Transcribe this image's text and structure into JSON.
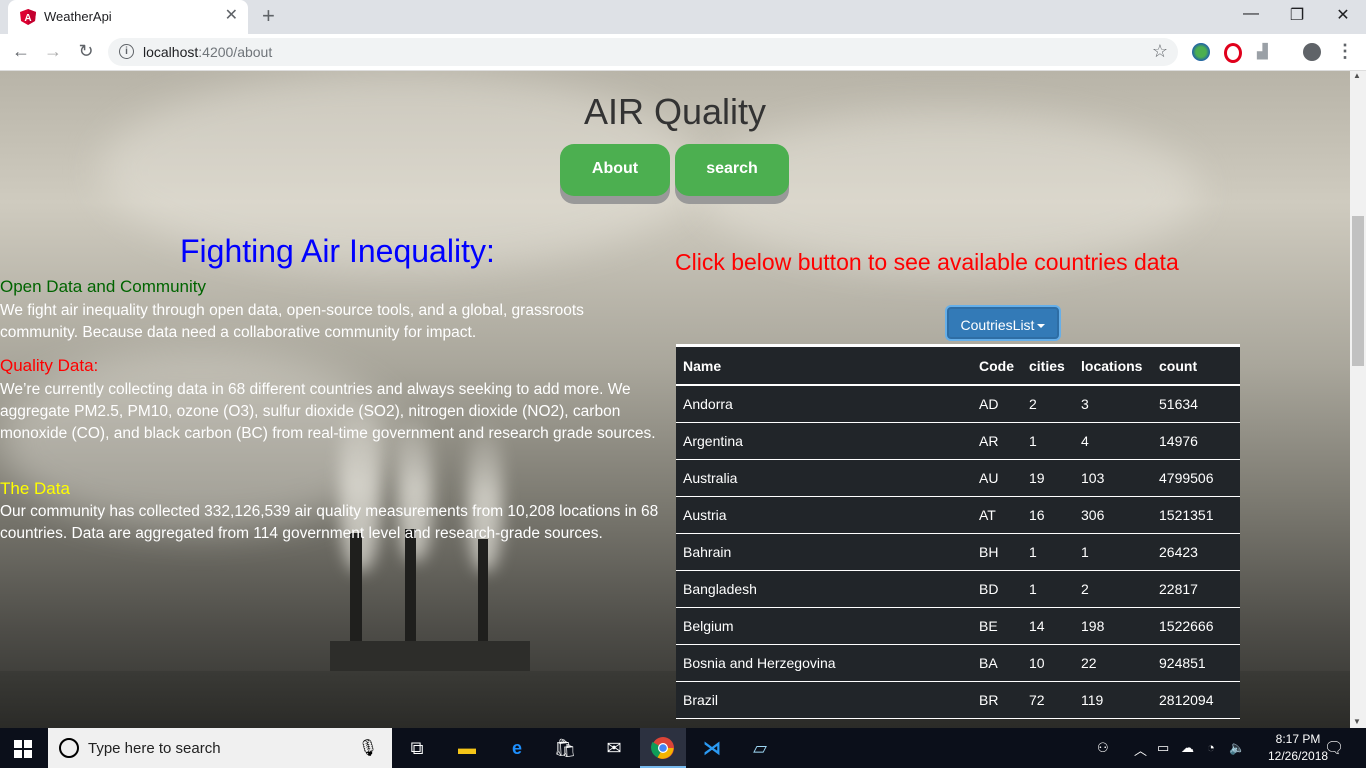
{
  "browser": {
    "tab_title": "WeatherApi",
    "tab_close": "✕",
    "new_tab": "+",
    "url_host": "localhost",
    "url_path": ":4200/about",
    "window_controls": {
      "minimize": "—",
      "restore": "❐",
      "close": "✕"
    }
  },
  "app": {
    "title": "AIR Quality",
    "nav": {
      "about": "About",
      "search": "search"
    }
  },
  "left": {
    "heading": "Fighting Air Inequality:",
    "sections": [
      {
        "title": "Open Data and Community",
        "color": "#006400",
        "text": "We fight air inequality through open data, open-source tools, and a global, grassroots community. Because data need a collaborative community for impact."
      },
      {
        "title": "Quality Data:",
        "color": "#ff0000",
        "text": "We’re currently collecting data in 68 different countries and always seeking to add more. We aggregate PM2.5, PM10, ozone (O3), sulfur dioxide (SO2), nitrogen dioxide (NO2), carbon monoxide (CO), and black carbon (BC) from real-time government and research grade sources."
      },
      {
        "title": "The Data",
        "color": "#ffff00",
        "text": "Our community has collected 332,126,539 air quality measurements from 10,208 locations in 68 countries. Data are aggregated from 114 government level and research-grade sources."
      }
    ]
  },
  "right": {
    "cta": "Click below button to see available countries data",
    "dropdown_label": "CoutriesList",
    "table": {
      "headers": [
        "Name",
        "Code",
        "cities",
        "locations",
        "count"
      ],
      "rows": [
        [
          "Andorra",
          "AD",
          "2",
          "3",
          "51634"
        ],
        [
          "Argentina",
          "AR",
          "1",
          "4",
          "14976"
        ],
        [
          "Australia",
          "AU",
          "19",
          "103",
          "4799506"
        ],
        [
          "Austria",
          "AT",
          "16",
          "306",
          "1521351"
        ],
        [
          "Bahrain",
          "BH",
          "1",
          "1",
          "26423"
        ],
        [
          "Bangladesh",
          "BD",
          "1",
          "2",
          "22817"
        ],
        [
          "Belgium",
          "BE",
          "14",
          "198",
          "1522666"
        ],
        [
          "Bosnia and Herzegovina",
          "BA",
          "10",
          "22",
          "924851"
        ],
        [
          "Brazil",
          "BR",
          "72",
          "119",
          "2812094"
        ]
      ]
    }
  },
  "taskbar": {
    "search_placeholder": "Type here to search",
    "time": "8:17 PM",
    "date": "12/26/2018"
  },
  "colors": {
    "nav_button": "#4caf50",
    "dropdown": "#337ab7",
    "table_bg": "#212529",
    "heading_blue": "#0000ff"
  }
}
